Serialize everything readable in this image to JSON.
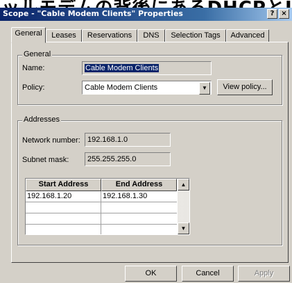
{
  "banner": {
    "text": "ッルモデムの背後にあるDHCPとIP"
  },
  "window": {
    "title": "Scope - \"Cable Modem Clients\" Properties",
    "help_button": "?",
    "close_button": "×"
  },
  "tabs": [
    {
      "label": "General",
      "active": true
    },
    {
      "label": "Leases",
      "active": false
    },
    {
      "label": "Reservations",
      "active": false
    },
    {
      "label": "DNS",
      "active": false
    },
    {
      "label": "Selection Tags",
      "active": false
    },
    {
      "label": "Advanced",
      "active": false
    }
  ],
  "general": {
    "group_label": "General",
    "name_label": "Name:",
    "name_value": "Cable Modem Clients",
    "policy_label": "Policy:",
    "policy_value": "Cable Modem Clients",
    "view_policy_button": "View policy..."
  },
  "addresses": {
    "group_label": "Addresses",
    "network_label": "Network number:",
    "network_value": "192.168.1.0",
    "subnet_label": "Subnet mask:",
    "subnet_value": "255.255.255.0",
    "columns": [
      "Start Address",
      "End Address"
    ],
    "rows": [
      {
        "start": "192.168.1.20",
        "end": "192.168.1.30"
      },
      {
        "start": "",
        "end": ""
      },
      {
        "start": "",
        "end": ""
      },
      {
        "start": "",
        "end": ""
      }
    ]
  },
  "buttons": {
    "ok": "OK",
    "cancel": "Cancel",
    "apply": "Apply"
  }
}
